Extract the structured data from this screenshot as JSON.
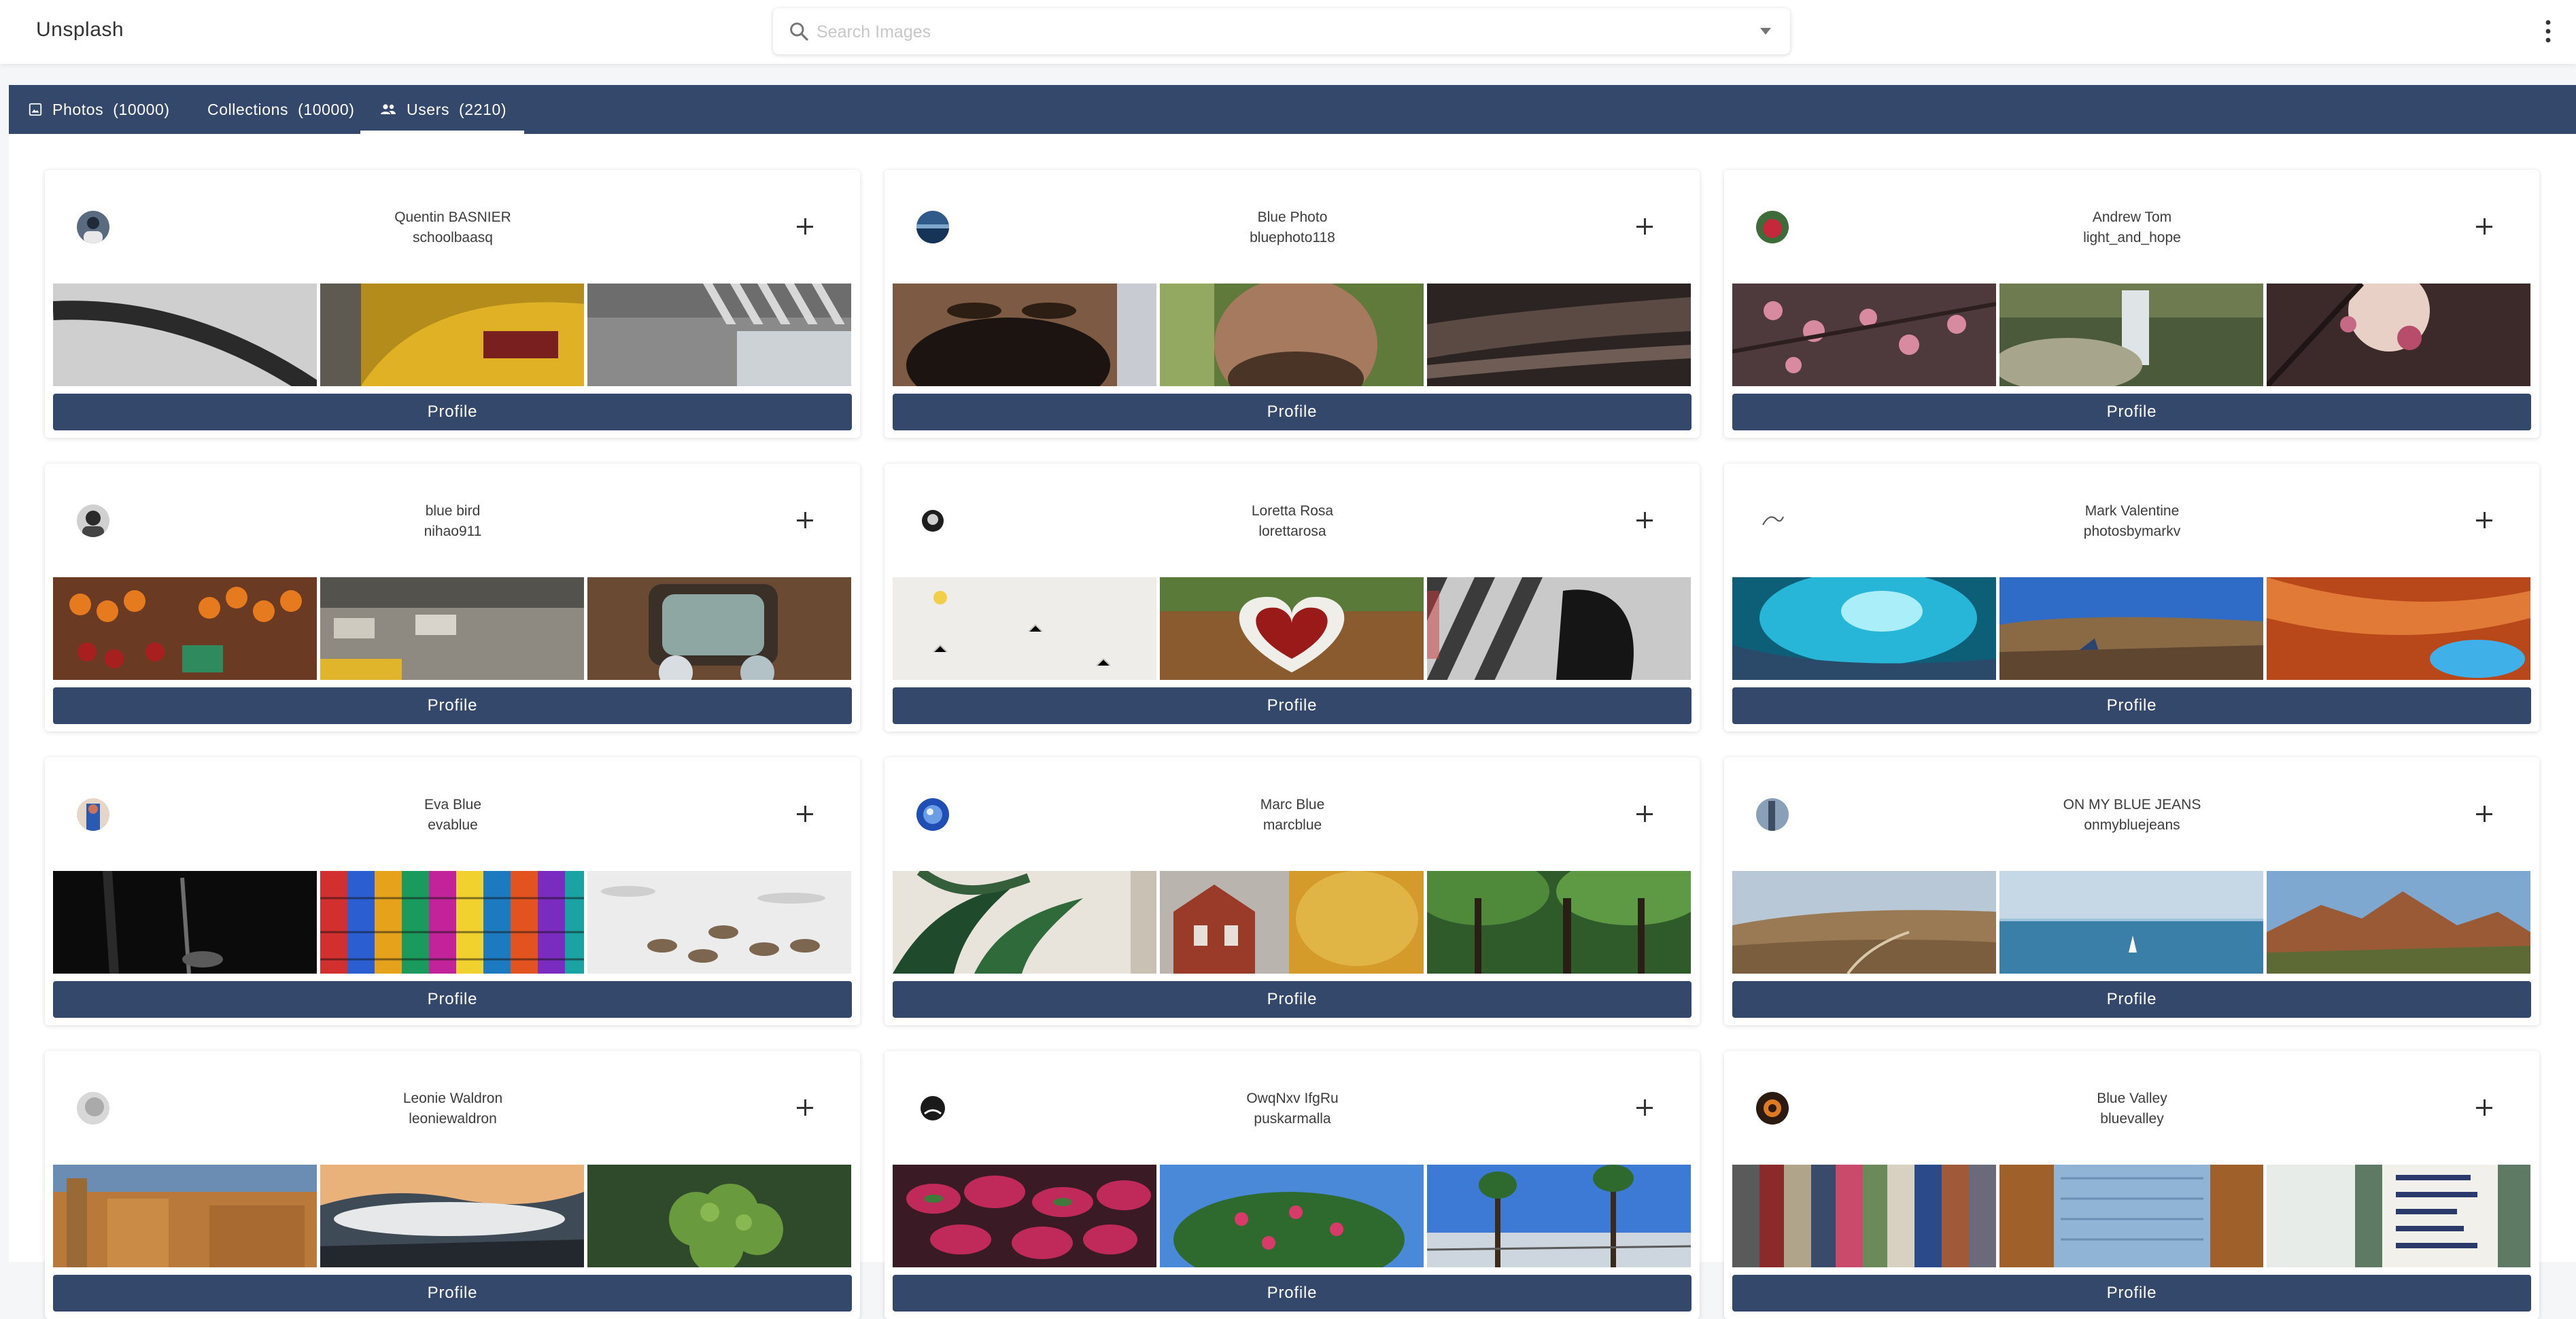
{
  "app": {
    "title": "Unsplash"
  },
  "search": {
    "placeholder": "Search Images",
    "value": ""
  },
  "tabs": [
    {
      "label": "Photos",
      "count": "(10000)",
      "icon": "image-icon",
      "active": false
    },
    {
      "label": "Collections",
      "count": "(10000)",
      "icon": "",
      "active": false
    },
    {
      "label": "Users",
      "count": "(2210)",
      "icon": "people-icon",
      "active": true
    }
  ],
  "colors": {
    "primary": "#34486b",
    "background": "#f5f6f8",
    "surface": "#ffffff"
  },
  "users": [
    {
      "name": "Quentin BASNIER",
      "username": "schoolbaasq",
      "button": "Profile"
    },
    {
      "name": "Blue Photo",
      "username": "bluephoto118",
      "button": "Profile"
    },
    {
      "name": "Andrew Tom",
      "username": "light_and_hope",
      "button": "Profile"
    },
    {
      "name": "blue bird",
      "username": "nihao911",
      "button": "Profile"
    },
    {
      "name": "Loretta Rosa",
      "username": "lorettarosa",
      "button": "Profile"
    },
    {
      "name": "Mark Valentine",
      "username": "photosbymarkv",
      "button": "Profile"
    },
    {
      "name": "Eva Blue",
      "username": "evablue",
      "button": "Profile"
    },
    {
      "name": "Marc Blue",
      "username": "marcblue",
      "button": "Profile"
    },
    {
      "name": "ON MY BLUE JEANS",
      "username": "onmybluejeans",
      "button": "Profile"
    },
    {
      "name": "Leonie Waldron",
      "username": "leoniewaldron",
      "button": "Profile"
    },
    {
      "name": "OwqNxv IfgRu",
      "username": "puskarmalla",
      "button": "Profile"
    },
    {
      "name": "Blue Valley",
      "username": "bluevalley",
      "button": "Profile"
    }
  ]
}
